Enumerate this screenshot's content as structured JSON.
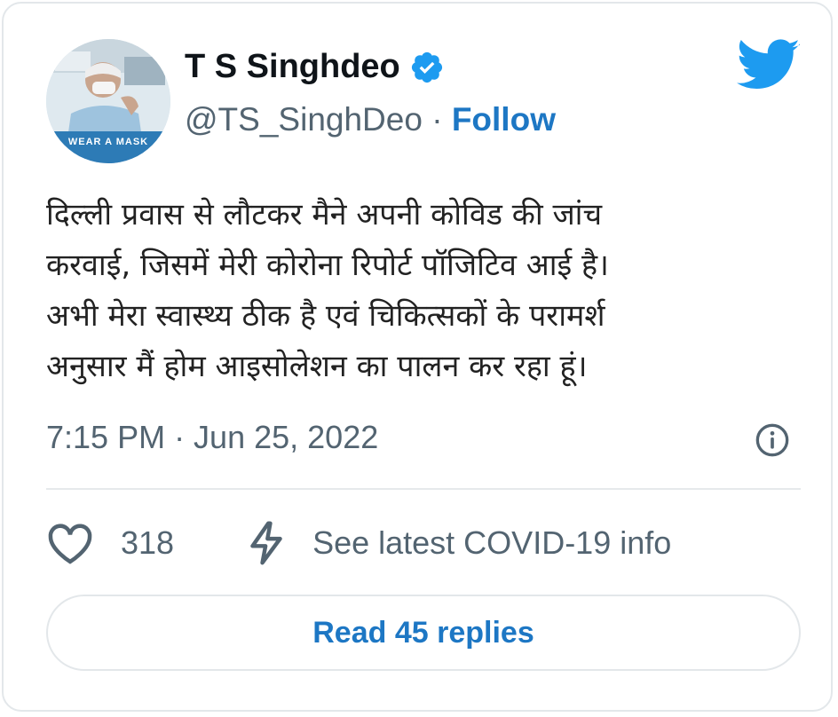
{
  "author": {
    "name": "T S Singhdeo",
    "handle": "@TS_SinghDeo",
    "separator": "·",
    "follow_label": "Follow",
    "avatar_caption": "WEAR A MASK"
  },
  "tweet": {
    "text": "दिल्ली प्रवास से लौटकर मैने अपनी कोविड की जांच\nकरवाई, जिसमें मेरी कोरोना रिपोर्ट पॉजिटिव आई है।\nअभी मेरा स्वास्थ्य ठीक है एवं चिकित्सकों के परामर्श\nअनुसार मैं होम आइसोलेशन का पालन कर रहा हूं।",
    "timestamp": "7:15 PM · Jun 25, 2022"
  },
  "actions": {
    "like_count": "318",
    "covid_label": "See latest COVID-19 info"
  },
  "replies_button": "Read 45 replies",
  "colors": {
    "accent": "#1d9bf0",
    "link": "#1d77c4",
    "muted": "#536471",
    "border": "#e3e7ea"
  },
  "icons": [
    "twitter-bird-icon",
    "verified-badge-icon",
    "info-icon",
    "heart-icon",
    "lightning-icon"
  ]
}
